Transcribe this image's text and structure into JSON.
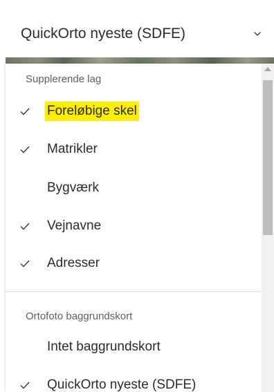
{
  "select": {
    "value": "QuickOrto nyeste (SDFE)",
    "icon": "chevron-down-icon"
  },
  "groups": [
    {
      "label": "Supplerende lag",
      "items": [
        {
          "label": "Foreløbige skel",
          "checked": true,
          "highlighted": true
        },
        {
          "label": "Matrikler",
          "checked": true,
          "highlighted": false
        },
        {
          "label": "Bygværk",
          "checked": false,
          "highlighted": false
        },
        {
          "label": "Vejnavne",
          "checked": true,
          "highlighted": false
        },
        {
          "label": "Adresser",
          "checked": true,
          "highlighted": false
        }
      ]
    },
    {
      "label": "Ortofoto baggrundskort",
      "items": [
        {
          "label": "Intet baggrundskort",
          "checked": false,
          "highlighted": false
        },
        {
          "label": "QuickOrto nyeste (SDFE)",
          "checked": true,
          "highlighted": false
        }
      ]
    }
  ],
  "colors": {
    "highlight": "#ffee00",
    "text": "#2b2b2b",
    "muted_text": "#5f5f5f",
    "scroll_thumb": "#bdbdbd"
  }
}
